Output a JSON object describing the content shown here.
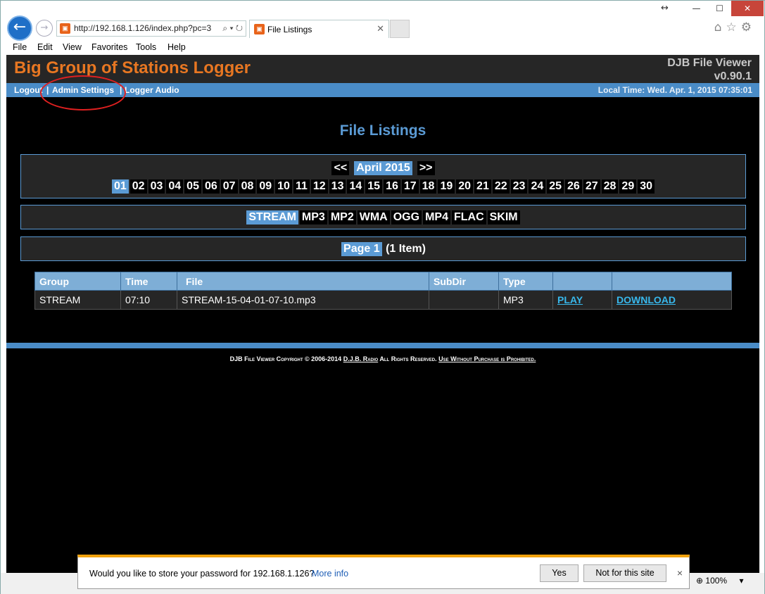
{
  "browser": {
    "address_url": "http://192.168.1.126/index.php?pc=3",
    "tab_title": "File Listings",
    "zoom": "100%",
    "menu": [
      "File",
      "Edit",
      "View",
      "Favorites",
      "Tools",
      "Help"
    ]
  },
  "header": {
    "site_title": "Big Group of Stations Logger",
    "app_name": "DJB File Viewer",
    "version": "v0.90.1"
  },
  "nav": {
    "logout": "Logout",
    "admin_settings": "Admin Settings",
    "logger_audio": "Logger Audio",
    "separator": "|",
    "clock": "Local Time: Wed. Apr. 1, 2015  07:35:01"
  },
  "main": {
    "heading": "File Listings",
    "prev": "<<",
    "month": "April 2015",
    "next": ">>",
    "days": [
      "01",
      "02",
      "03",
      "04",
      "05",
      "06",
      "07",
      "08",
      "09",
      "10",
      "11",
      "12",
      "13",
      "14",
      "15",
      "16",
      "17",
      "18",
      "19",
      "20",
      "21",
      "22",
      "23",
      "24",
      "25",
      "26",
      "27",
      "28",
      "29",
      "30"
    ],
    "selected_day": "01",
    "types": [
      "STREAM",
      "MP3",
      "MP2",
      "WMA",
      "OGG",
      "MP4",
      "FLAC",
      "SKIM"
    ],
    "selected_type": "STREAM",
    "page_label": "Page 1",
    "item_count": "(1 Item)"
  },
  "table": {
    "columns": [
      "Group",
      "Time",
      "File",
      "SubDir",
      "Type",
      "",
      ""
    ],
    "rows": [
      {
        "group": "STREAM",
        "time": "07:10",
        "file": "STREAM-15-04-01-07-10.mp3",
        "subdir": "",
        "type": "MP3",
        "play": "PLAY",
        "download": "DOWNLOAD"
      }
    ]
  },
  "footer": {
    "copyright": "DJB File Viewer Copyright © 2006-2014",
    "company": "D.J.B. Radio",
    "rights": "All Rights Reserved.",
    "notice": "Use Without Purchase is Prohibited."
  },
  "notification": {
    "message": "Would you like to store your password for 192.168.1.126?",
    "more_info": "More info",
    "yes": "Yes",
    "not_for_site": "Not for this site",
    "close": "×"
  },
  "colors": {
    "accent_blue": "#4a8cc7",
    "title_orange": "#e87722",
    "link_cyan": "#38b8ec",
    "annotation_red": "#e02020"
  }
}
